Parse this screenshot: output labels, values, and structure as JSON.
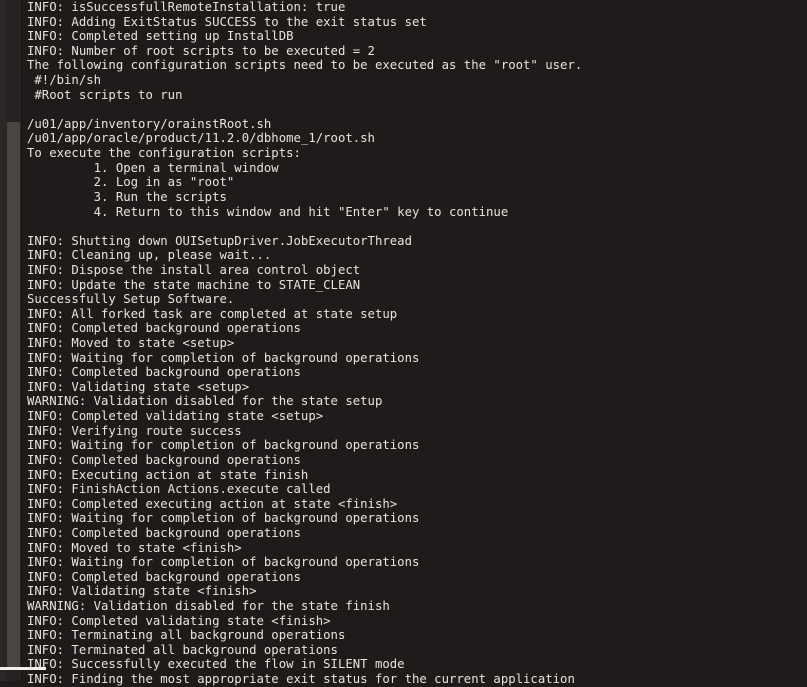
{
  "window": {
    "title": "Installer Console Output",
    "background_color": "#1e1b1a",
    "text_color": "#e8e4de"
  },
  "scrollbars": {
    "vertical": {
      "name": "vertical-scrollbar",
      "track_color": "#262221",
      "thumb_color": "#4b4443",
      "position": "left"
    },
    "horizontal": {
      "name": "horizontal-scrollbar",
      "color": "#f2f0ee",
      "position": "bottom-left"
    }
  },
  "console": {
    "lines": [
      "INFO: isSuccessfullRemoteInstallation: true",
      "INFO: Adding ExitStatus SUCCESS to the exit status set",
      "INFO: Completed setting up InstallDB",
      "INFO: Number of root scripts to be executed = 2",
      "The following configuration scripts need to be executed as the \"root\" user.",
      " #!/bin/sh",
      " #Root scripts to run",
      "",
      "/u01/app/inventory/orainstRoot.sh",
      "/u01/app/oracle/product/11.2.0/dbhome_1/root.sh",
      "To execute the configuration scripts:",
      "         1. Open a terminal window",
      "         2. Log in as \"root\"",
      "         3. Run the scripts",
      "         4. Return to this window and hit \"Enter\" key to continue",
      "",
      "INFO: Shutting down OUISetupDriver.JobExecutorThread",
      "INFO: Cleaning up, please wait...",
      "INFO: Dispose the install area control object",
      "INFO: Update the state machine to STATE_CLEAN",
      "Successfully Setup Software.",
      "INFO: All forked task are completed at state setup",
      "INFO: Completed background operations",
      "INFO: Moved to state <setup>",
      "INFO: Waiting for completion of background operations",
      "INFO: Completed background operations",
      "INFO: Validating state <setup>",
      "WARNING: Validation disabled for the state setup",
      "INFO: Completed validating state <setup>",
      "INFO: Verifying route success",
      "INFO: Waiting for completion of background operations",
      "INFO: Completed background operations",
      "INFO: Executing action at state finish",
      "INFO: FinishAction Actions.execute called",
      "INFO: Completed executing action at state <finish>",
      "INFO: Waiting for completion of background operations",
      "INFO: Completed background operations",
      "INFO: Moved to state <finish>",
      "INFO: Waiting for completion of background operations",
      "INFO: Completed background operations",
      "INFO: Validating state <finish>",
      "WARNING: Validation disabled for the state finish",
      "INFO: Completed validating state <finish>",
      "INFO: Terminating all background operations",
      "INFO: Terminated all background operations",
      "INFO: Successfully executed the flow in SILENT mode",
      "INFO: Finding the most appropriate exit status for the current application"
    ]
  }
}
